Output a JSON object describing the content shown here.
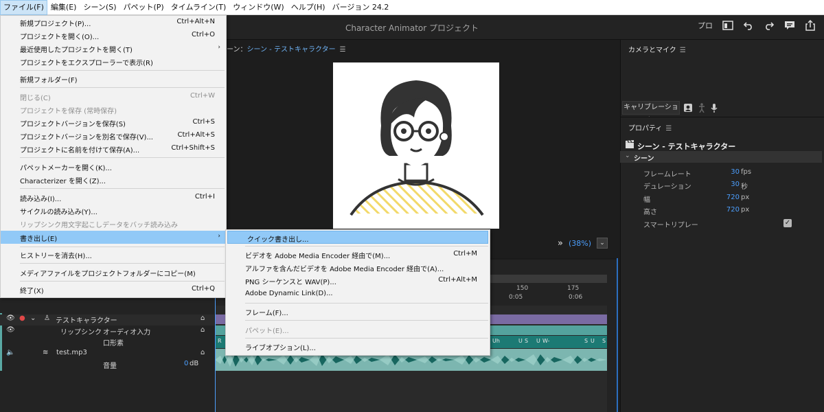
{
  "menubar": [
    "ファイル(F)",
    "編集(E)",
    "シーン(S)",
    "パペット(P)",
    "タイムライン(T)",
    "ウィンドウ(W)",
    "ヘルプ(H)",
    "バージョン 24.2"
  ],
  "header": {
    "title": "Character Animator プロジェクト",
    "mode": "プロ"
  },
  "scene_tab": "シーン - テストキャラクター",
  "scene_tab_prefix": "ーン：",
  "zoom_level": "(38%)",
  "camera_panel": {
    "title": "カメラとマイク",
    "calibrate": "キャリブレーション"
  },
  "properties": {
    "title": "プロパティ",
    "scene_name": "シーン - テストキャラクター",
    "section": "シーン",
    "rows": [
      {
        "label": "フレームレート",
        "value": "30",
        "unit": "fps"
      },
      {
        "label": "デュレーション",
        "value": "30",
        "unit": "秒"
      },
      {
        "label": "幅",
        "value": "720",
        "unit": "px"
      },
      {
        "label": "高さ",
        "value": "720",
        "unit": "px"
      },
      {
        "label": "スマートリプレー",
        "value": "",
        "unit": ""
      }
    ],
    "smart_replay_checked": true
  },
  "timeline": {
    "ticks": [
      "150",
      "175"
    ],
    "times": [
      "0:05",
      "0:06"
    ],
    "visemes": [
      "R",
      "Uh",
      "U",
      "S",
      "U",
      "W-",
      "S",
      "U",
      "S"
    ],
    "layers": {
      "character": "テストキャラクター",
      "lipsync": "リップシンク",
      "audio_input": "オーディオ入力",
      "mouth": "口形素",
      "audio_file": "test.mp3",
      "volume": "音量",
      "volume_value": "0",
      "volume_unit": "dB"
    }
  },
  "file_menu": {
    "items": [
      {
        "label": "新規プロジェクト(P)...",
        "shortcut": "Ctrl+Alt+N"
      },
      {
        "label": "プロジェクトを開く(O)...",
        "shortcut": "Ctrl+O"
      },
      {
        "label": "最近使用したプロジェクトを開く(T)",
        "shortcut": ""
      },
      {
        "label": "プロジェクトをエクスプローラーで表示(R)",
        "shortcut": ""
      },
      {
        "label": "新規フォルダー(F)",
        "shortcut": ""
      },
      {
        "label": "閉じる(C)",
        "shortcut": "Ctrl+W"
      },
      {
        "label": "プロジェクトを保存 (常時保存)",
        "shortcut": ""
      },
      {
        "label": "プロジェクトバージョンを保存(S)",
        "shortcut": "Ctrl+S"
      },
      {
        "label": "プロジェクトバージョンを別名で保存(V)...",
        "shortcut": "Ctrl+Alt+S"
      },
      {
        "label": "プロジェクトに名前を付けて保存(A)...",
        "shortcut": "Ctrl+Shift+S"
      },
      {
        "label": "パペットメーカーを開く(K)...",
        "shortcut": ""
      },
      {
        "label": "Characterizer を開く(Z)...",
        "shortcut": ""
      },
      {
        "label": "読み込み(I)...",
        "shortcut": "Ctrl+I"
      },
      {
        "label": "サイクルの読み込み(Y)...",
        "shortcut": ""
      },
      {
        "label": "リップシンク用文字起こしデータをバッチ読み込み",
        "shortcut": ""
      },
      {
        "label": "書き出し(E)",
        "shortcut": ""
      },
      {
        "label": "ヒストリーを消去(H)...",
        "shortcut": ""
      },
      {
        "label": "メディアファイルをプロジェクトフォルダーにコピー(M)",
        "shortcut": ""
      },
      {
        "label": "終了(X)",
        "shortcut": "Ctrl+Q"
      }
    ]
  },
  "export_submenu": {
    "items": [
      {
        "label": "クイック書き出し...",
        "shortcut": ""
      },
      {
        "label": "ビデオを Adobe Media Encoder 経由で(M)...",
        "shortcut": "Ctrl+M"
      },
      {
        "label": "アルファを含んだビデオを Adobe Media Encoder 経由で(A)...",
        "shortcut": ""
      },
      {
        "label": "PNG シーケンスと WAV(P)...",
        "shortcut": "Ctrl+Alt+M"
      },
      {
        "label": "Adobe Dynamic Link(D)...",
        "shortcut": ""
      },
      {
        "label": "フレーム(F)...",
        "shortcut": ""
      },
      {
        "label": "パペット(E)...",
        "shortcut": ""
      },
      {
        "label": "ライブオプション(L)...",
        "shortcut": ""
      }
    ]
  },
  "colors": {
    "accent": "#4c9ffe",
    "highlight": "#91c9f7",
    "track_purple": "#7a6ba3",
    "track_teal": "#54a39e"
  }
}
